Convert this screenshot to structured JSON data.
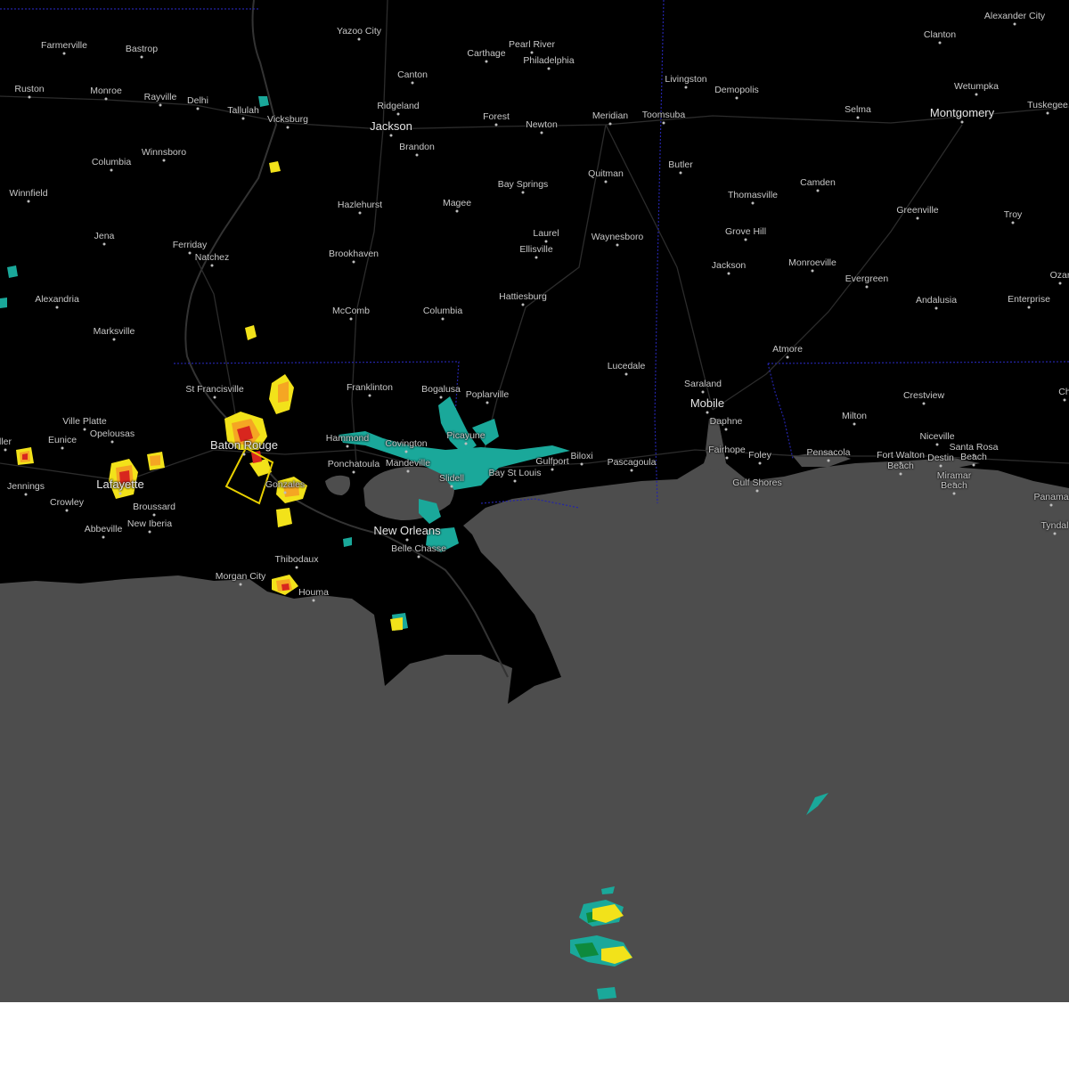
{
  "colors": {
    "land": "#000000",
    "water": "#4d4d4d",
    "roads": "#2e2e2e",
    "state_border": "#2222aa",
    "warning_polygon": "#e8d000",
    "radar_light": "#1aa89a",
    "radar_moderate": "#0e8a3c",
    "radar_heavy": "#f2e21a",
    "radar_severe": "#f5a623",
    "radar_extreme": "#d8261e"
  },
  "cities": [
    {
      "name": "Farmerville"
    },
    {
      "name": "Bastrop"
    },
    {
      "name": "Yazoo City"
    },
    {
      "name": "Carthage"
    },
    {
      "name": "Pearl River"
    },
    {
      "name": "Philadelphia"
    },
    {
      "name": "Clanton"
    },
    {
      "name": "Alexander City"
    },
    {
      "name": "Canton"
    },
    {
      "name": "Livingston"
    },
    {
      "name": "Demopolis"
    },
    {
      "name": "Wetumpka"
    },
    {
      "name": "Ruston"
    },
    {
      "name": "Monroe"
    },
    {
      "name": "Rayville"
    },
    {
      "name": "Delhi"
    },
    {
      "name": "Tallulah"
    },
    {
      "name": "Ridgeland"
    },
    {
      "name": "Vicksburg"
    },
    {
      "name": "Jackson",
      "major": true
    },
    {
      "name": "Forest"
    },
    {
      "name": "Meridian"
    },
    {
      "name": "Toomsuba"
    },
    {
      "name": "Newton"
    },
    {
      "name": "Selma"
    },
    {
      "name": "Montgomery",
      "major": true
    },
    {
      "name": "Tuskegee"
    },
    {
      "name": "Brandon"
    },
    {
      "name": "Winnsboro"
    },
    {
      "name": "Columbia"
    },
    {
      "name": "Butler"
    },
    {
      "name": "Quitman"
    },
    {
      "name": "Winnfield"
    },
    {
      "name": "Hazlehurst"
    },
    {
      "name": "Magee"
    },
    {
      "name": "Bay Springs"
    },
    {
      "name": "Thomasville"
    },
    {
      "name": "Camden"
    },
    {
      "name": "Greenville"
    },
    {
      "name": "Troy"
    },
    {
      "name": "Jena"
    },
    {
      "name": "Ferriday"
    },
    {
      "name": "Natchez"
    },
    {
      "name": "Laurel"
    },
    {
      "name": "Ellisville"
    },
    {
      "name": "Waynesboro"
    },
    {
      "name": "Grove Hill"
    },
    {
      "name": "Brookhaven"
    },
    {
      "name": "Monroeville"
    },
    {
      "name": "Jackson"
    },
    {
      "name": "Evergreen"
    },
    {
      "name": "Alexandria"
    },
    {
      "name": "Hattiesburg"
    },
    {
      "name": "McComb"
    },
    {
      "name": "Columbia"
    },
    {
      "name": "Andalusia"
    },
    {
      "name": "Enterprise"
    },
    {
      "name": "Ozar"
    },
    {
      "name": "Marksville"
    },
    {
      "name": "Atmore"
    },
    {
      "name": "Lucedale"
    },
    {
      "name": "St Francisville"
    },
    {
      "name": "Franklinton"
    },
    {
      "name": "Bogalusa"
    },
    {
      "name": "Poplarville"
    },
    {
      "name": "Saraland"
    },
    {
      "name": "Crestview"
    },
    {
      "name": "Ch"
    },
    {
      "name": "Ville Platte"
    },
    {
      "name": "Mobile",
      "major": true
    },
    {
      "name": "Milton"
    },
    {
      "name": "Opelousas"
    },
    {
      "name": "Picayune"
    },
    {
      "name": "Eunice"
    },
    {
      "name": "Baton Rouge",
      "major": true
    },
    {
      "name": "Hammond"
    },
    {
      "name": "Covington"
    },
    {
      "name": "Niceville"
    },
    {
      "name": "Daphne"
    },
    {
      "name": "Santa Rosa"
    },
    {
      "name": "ller"
    },
    {
      "name": "Fairhope"
    },
    {
      "name": "Foley"
    },
    {
      "name": "Pensacola"
    },
    {
      "name": "Fort Walton"
    },
    {
      "name": "Destin"
    },
    {
      "name": "Beach"
    },
    {
      "name": "Beach"
    },
    {
      "name": "Ponchatoula"
    },
    {
      "name": "Mandeville"
    },
    {
      "name": "Gulfport"
    },
    {
      "name": "Biloxi"
    },
    {
      "name": "Bay St Louis"
    },
    {
      "name": "Pascagoula"
    },
    {
      "name": "Slidell"
    },
    {
      "name": "Miramar"
    },
    {
      "name": "Beach"
    },
    {
      "name": "Jennings"
    },
    {
      "name": "Lafayette",
      "major": true
    },
    {
      "name": "Gonzales"
    },
    {
      "name": "Gulf Shores"
    },
    {
      "name": "Panama"
    },
    {
      "name": "Crowley"
    },
    {
      "name": "Broussard"
    },
    {
      "name": "Tyndal"
    },
    {
      "name": "Abbeville"
    },
    {
      "name": "New Iberia"
    },
    {
      "name": "New Orleans",
      "major": true
    },
    {
      "name": "Belle Chasse"
    },
    {
      "name": "Thibodaux"
    },
    {
      "name": "Morgan City"
    },
    {
      "name": "Houma"
    }
  ]
}
